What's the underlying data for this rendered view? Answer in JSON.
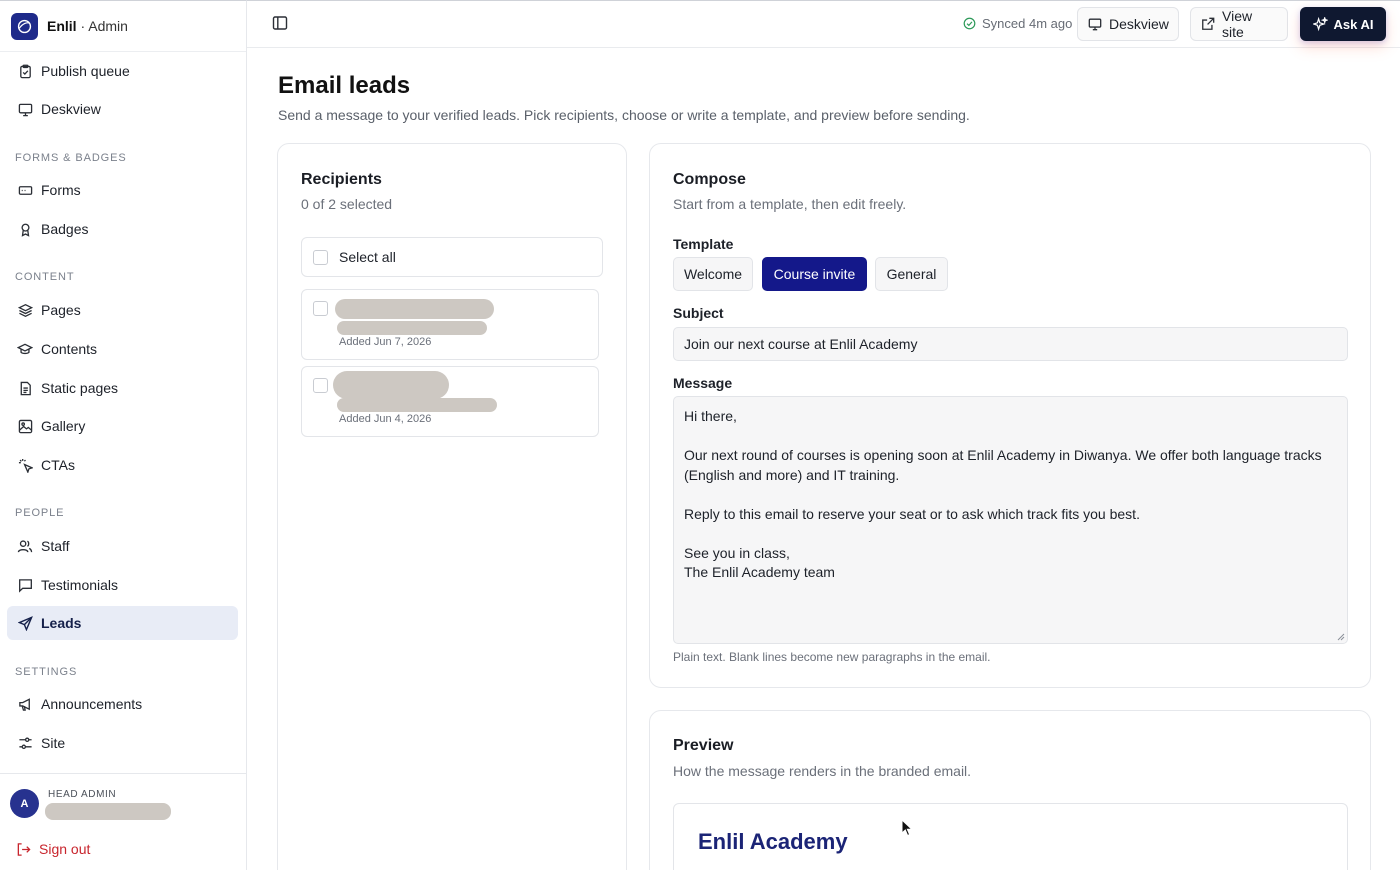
{
  "brand": {
    "name": "Enlil",
    "separator": " · ",
    "suffix": "Admin"
  },
  "sidebar": {
    "top_items": [
      {
        "label": "Publish queue",
        "icon": "clipboard-check-icon"
      },
      {
        "label": "Deskview",
        "icon": "monitor-icon"
      }
    ],
    "sections": [
      {
        "label": "FORMS & BADGES",
        "items": [
          {
            "label": "Forms",
            "icon": "form-icon"
          },
          {
            "label": "Badges",
            "icon": "badge-icon"
          }
        ]
      },
      {
        "label": "CONTENT",
        "items": [
          {
            "label": "Pages",
            "icon": "layers-icon"
          },
          {
            "label": "Contents",
            "icon": "graduation-cap-icon"
          },
          {
            "label": "Static pages",
            "icon": "file-text-icon"
          },
          {
            "label": "Gallery",
            "icon": "image-icon"
          },
          {
            "label": "CTAs",
            "icon": "click-icon"
          }
        ]
      },
      {
        "label": "PEOPLE",
        "items": [
          {
            "label": "Staff",
            "icon": "users-icon"
          },
          {
            "label": "Testimonials",
            "icon": "message-square-icon"
          },
          {
            "label": "Leads",
            "icon": "send-icon",
            "active": true
          }
        ]
      },
      {
        "label": "SETTINGS",
        "items": [
          {
            "label": "Announcements",
            "icon": "megaphone-icon"
          },
          {
            "label": "Site",
            "icon": "sliders-icon"
          }
        ]
      }
    ],
    "footer": {
      "avatar_initial": "A",
      "role": "HEAD ADMIN",
      "sign_out": "Sign out"
    }
  },
  "topbar": {
    "sync_status": "Synced 4m ago",
    "deskview_label": "Deskview",
    "view_site_label": "View site",
    "ask_ai_label": "Ask AI"
  },
  "main": {
    "title": "Email leads",
    "subtitle": "Send a message to your verified leads. Pick recipients, choose or write a template, and preview before sending."
  },
  "recipients": {
    "title": "Recipients",
    "count": "0 of 2 selected",
    "select_all": "Select all",
    "items": [
      {
        "added": "Added Jun 7, 2026"
      },
      {
        "added": "Added Jun 4, 2026"
      }
    ]
  },
  "compose": {
    "title": "Compose",
    "subtitle": "Start from a template, then edit freely.",
    "template_label": "Template",
    "templates": [
      {
        "label": "Welcome",
        "active": false
      },
      {
        "label": "Course invite",
        "active": true
      },
      {
        "label": "General",
        "active": false
      }
    ],
    "subject_label": "Subject",
    "subject_value": "Join our next course at Enlil Academy",
    "message_label": "Message",
    "message_value": "Hi there,\n\nOur next round of courses is opening soon at Enlil Academy in Diwanya. We offer both language tracks (English and more) and IT training.\n\nReply to this email to reserve your seat or to ask which track fits you best.\n\nSee you in class,\nThe Enlil Academy team",
    "hint": "Plain text. Blank lines become new paragraphs in the email."
  },
  "preview": {
    "title": "Preview",
    "subtitle": "How the message renders in the branded email.",
    "brand": "Enlil Academy"
  },
  "colors": {
    "accent": "#14188a",
    "active_nav_bg": "#e8ecf6",
    "sign_out": "#c8252d",
    "sync_ok": "#2e9a5a"
  }
}
